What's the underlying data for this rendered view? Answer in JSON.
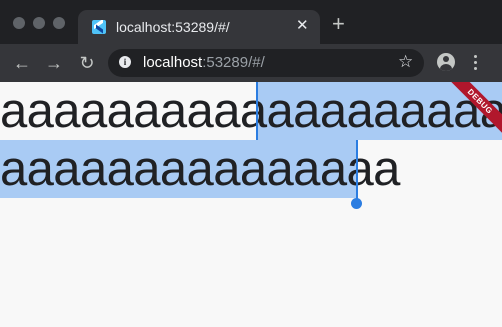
{
  "browser": {
    "tab": {
      "title": "localhost:53289/#/",
      "close_glyph": "✕",
      "favicon": "flutter-logo-icon"
    },
    "new_tab_glyph": "+",
    "nav": {
      "back_glyph": "←",
      "forward_glyph": "→",
      "reload_glyph": "↻"
    },
    "omnibox": {
      "info_glyph": "i",
      "url_host": "localhost",
      "url_rest": ":53289/#/",
      "bookmark_glyph": "☆"
    },
    "colors": {
      "frame": "#202124",
      "toolbar": "#35363a",
      "selection": "#a9cbf4",
      "caret": "#2b7de1",
      "debug_banner": "#b1172c"
    }
  },
  "page": {
    "line1_unselected": "aaaaaaaaaa",
    "line1_selected": "aaaaaaaaaa",
    "line2_selected": "aaaaaaaaaaaaaaa",
    "debug_banner": "DEBUG"
  }
}
